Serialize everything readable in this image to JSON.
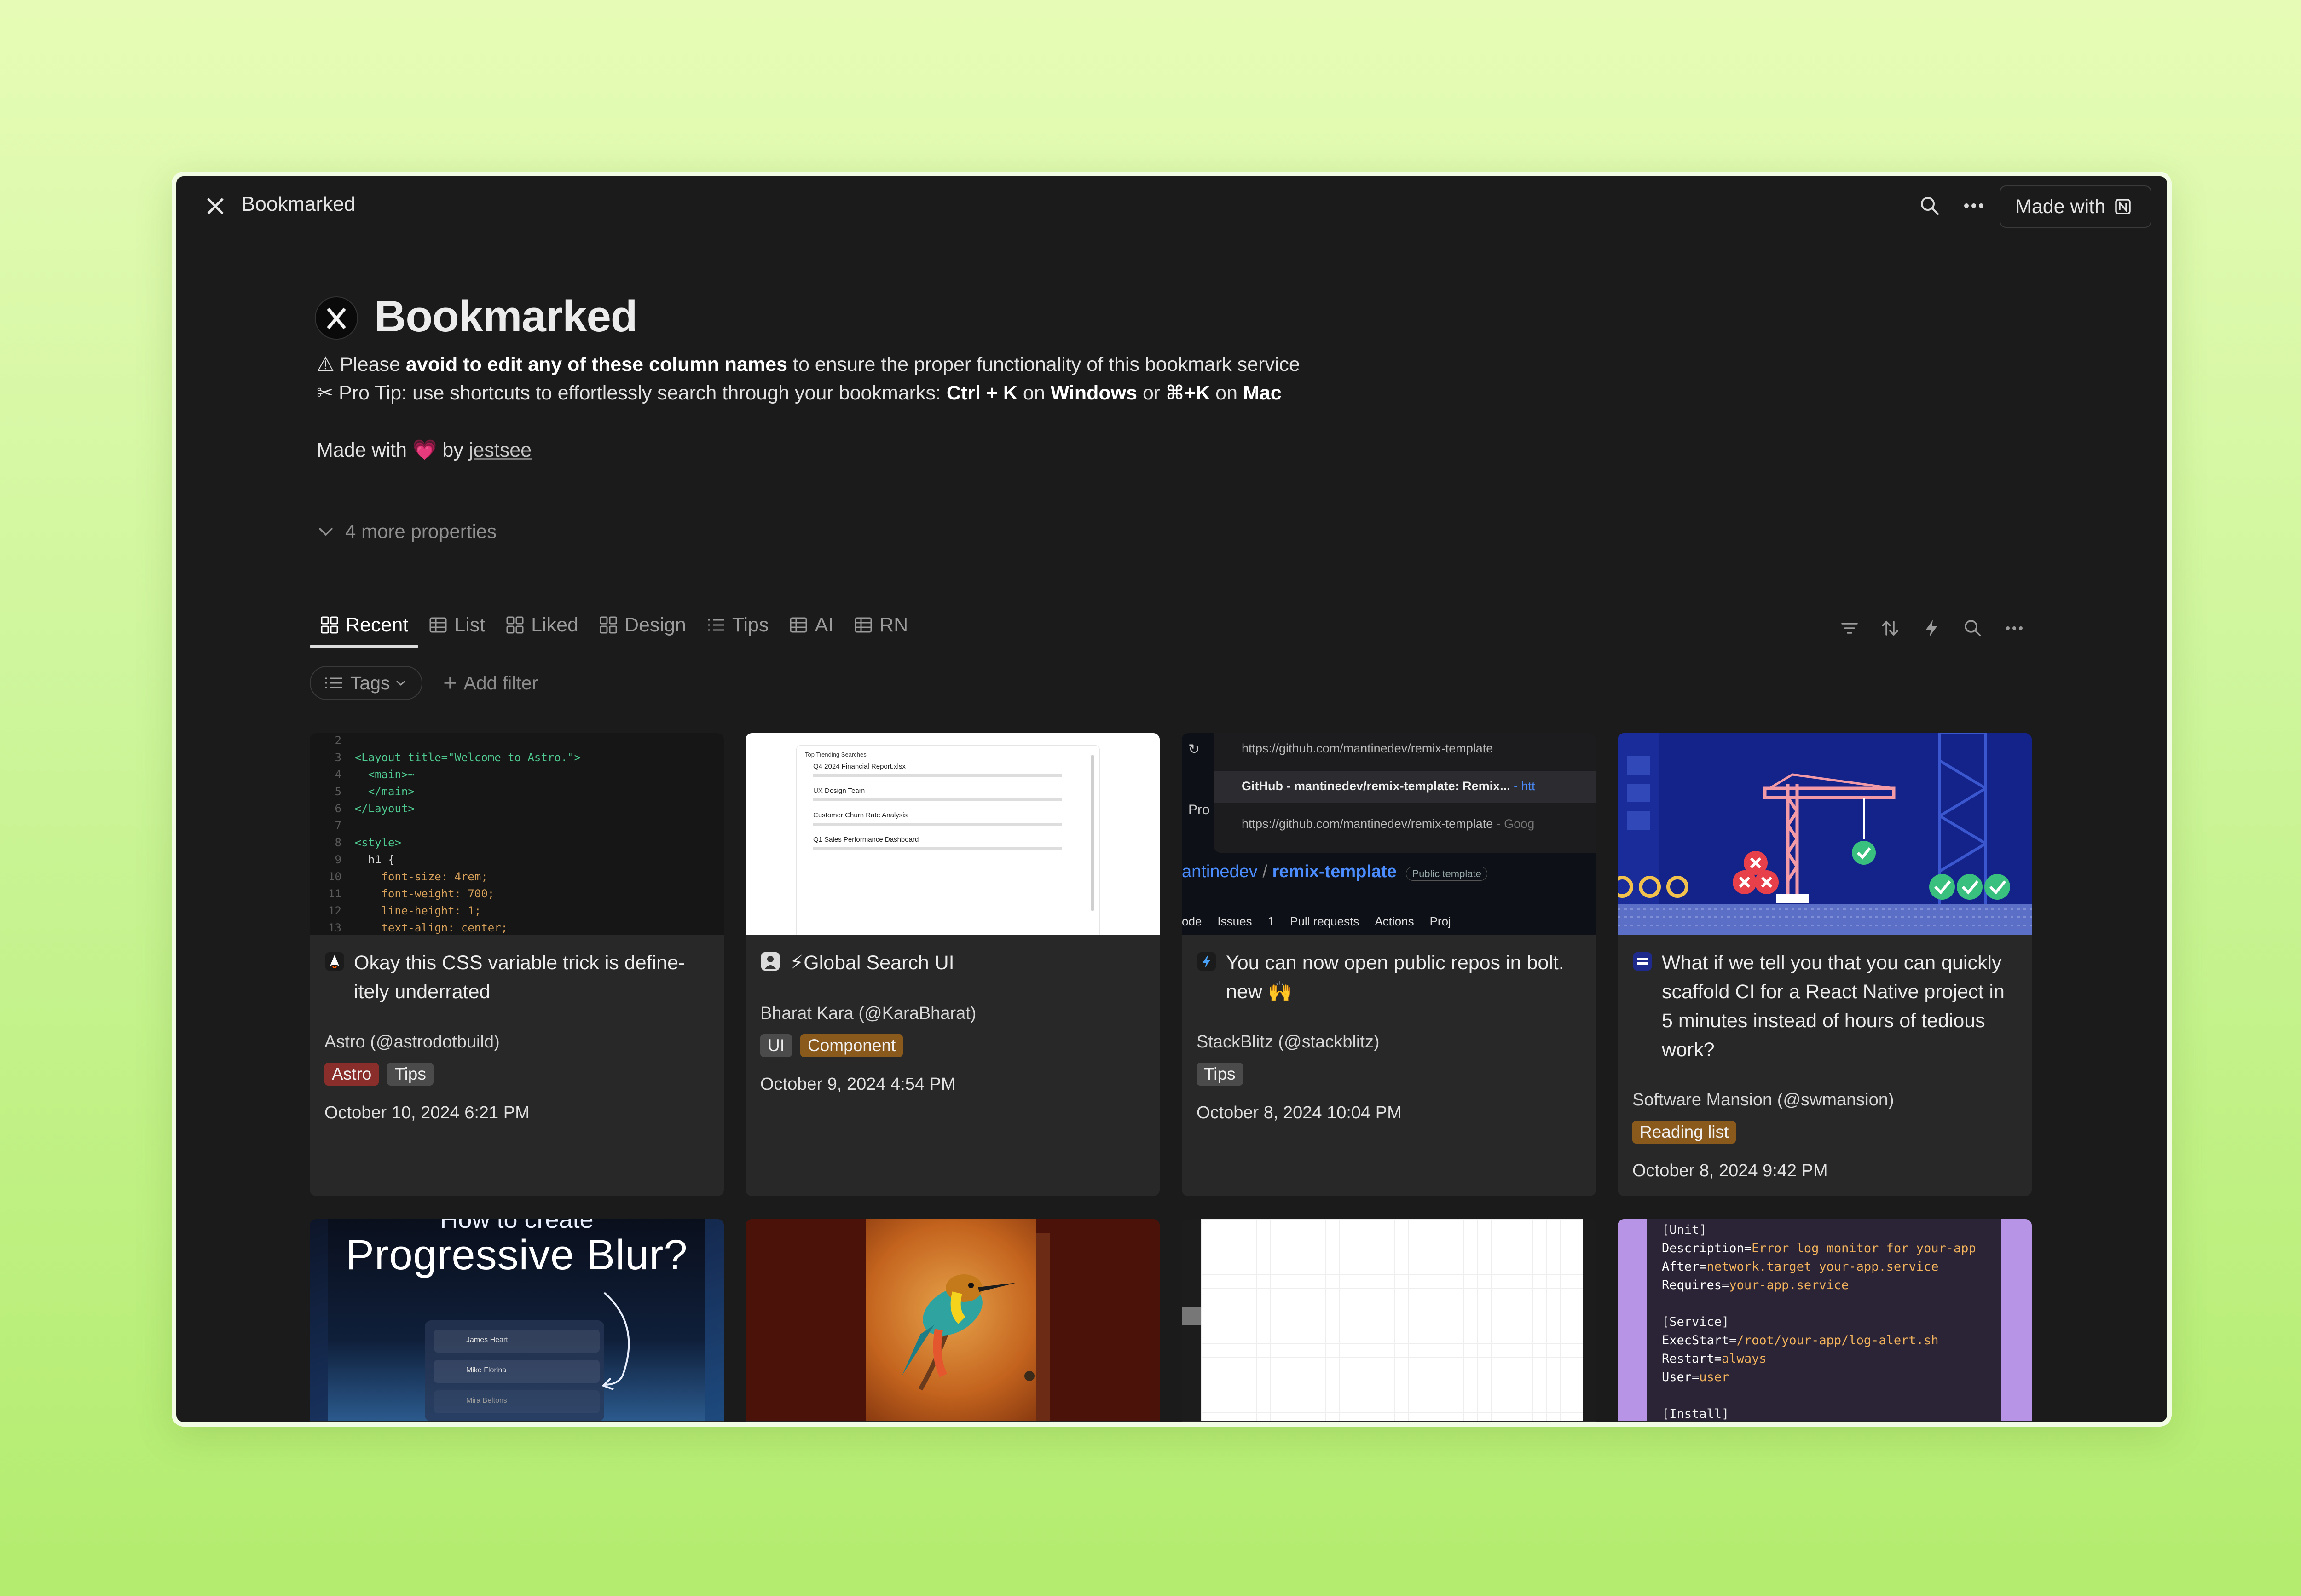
{
  "window": {
    "title": "Bookmarked",
    "made_with_label": "Made with"
  },
  "page": {
    "title": "Bookmarked",
    "line1": {
      "prefix": "⚠ Please ",
      "bold": "avoid to edit any of these column names",
      "suffix": " to ensure the proper functionality of this bookmark service"
    },
    "line2": {
      "prefix": "✂ Pro Tip: use shortcuts to effortlessly search through your bookmarks: ",
      "k1": "Ctrl + K",
      "on1": " on ",
      "os1": "Windows",
      "or": " or ",
      "k2": "⌘+K",
      "on2": " on ",
      "os2": "Mac"
    },
    "madewith": {
      "prefix": "Made with ",
      "heart": "💗",
      "by": " by ",
      "author": "jestsee"
    },
    "more_properties": "4 more properties"
  },
  "tabs": [
    {
      "label": "Recent",
      "icon": "gallery-icon",
      "active": true
    },
    {
      "label": "List",
      "icon": "table-icon"
    },
    {
      "label": "Liked",
      "icon": "gallery-icon"
    },
    {
      "label": "Design",
      "icon": "gallery-icon"
    },
    {
      "label": "Tips",
      "icon": "list-icon"
    },
    {
      "label": "AI",
      "icon": "table-icon"
    },
    {
      "label": "RN",
      "icon": "table-icon"
    }
  ],
  "filters": {
    "tags_label": "Tags",
    "add_filter_label": "Add filter"
  },
  "cards": [
    {
      "title": "Okay this CSS variable trick is define-itely underrated",
      "author": "Astro (@astrodotbuild)",
      "tags": [
        {
          "label": "Astro",
          "color": "#8a2e2b"
        },
        {
          "label": "Tips",
          "color": "#4b4b4b"
        }
      ],
      "date": "October 10, 2024 6:21 PM"
    },
    {
      "title": "⚡Global Search UI",
      "author": "Bharat Kara (@KaraBharat)",
      "tags": [
        {
          "label": "UI",
          "color": "#4b4b4b"
        },
        {
          "label": "Component",
          "color": "#8a5a1c"
        }
      ],
      "date": "October 9, 2024 4:54 PM"
    },
    {
      "title": "You can now open public repos in bolt. new 🙌",
      "author": "StackBlitz (@stackblitz)",
      "tags": [
        {
          "label": "Tips",
          "color": "#4b4b4b"
        }
      ],
      "date": "October 8, 2024 10:04 PM"
    },
    {
      "title": "What if we tell you that you can quickly scaffold CI for a React Native project in 5 minutes instead of hours of tedious work?",
      "author": "Software Mansion (@swmansion)",
      "tags": [
        {
          "label": "Reading list",
          "color": "#8a5a1c"
        }
      ],
      "date": "October 8, 2024 9:42 PM"
    }
  ],
  "thumbs": {
    "astro_code": [
      {
        "n": "2",
        "t": ""
      },
      {
        "n": "3",
        "t": "<Layout title=\"Welcome to Astro.\">"
      },
      {
        "n": "4",
        "t": "  <main>⋯"
      },
      {
        "n": "5",
        "t": "  </main>"
      },
      {
        "n": "6",
        "t": "</Layout>"
      },
      {
        "n": "7",
        "t": ""
      },
      {
        "n": "8",
        "t": "<style>"
      },
      {
        "n": "9",
        "t": "  h1 {"
      },
      {
        "n": "10",
        "t": "    font-size: 4rem;"
      },
      {
        "n": "11",
        "t": "    font-weight: 700;"
      },
      {
        "n": "12",
        "t": "    line-height: 1;"
      },
      {
        "n": "13",
        "t": "    text-align: center;"
      }
    ],
    "search_ui": {
      "heading": "Top Trending Searches",
      "items": [
        "Q4 2024 Financial Report.xlsx",
        "UX Design Team",
        "Customer Churn Rate Analysis",
        "Q1 Sales Performance Dashboard"
      ]
    },
    "github": {
      "row1": "https://github.com/mantinedev/remix-template",
      "row2": "GitHub - mantinedev/remix-template: Remix...",
      "row2_tail": " - htt",
      "row3": "https://github.com/mantinedev/remix-template",
      "row3_tail": " - Goog",
      "pro": "Pro",
      "repo_owner": "antinedev",
      "repo_name": "remix-template",
      "badge": "Public template",
      "nav": [
        "ode",
        "Issues",
        "1",
        "Pull requests",
        "Actions",
        "Proj"
      ]
    },
    "progressive": {
      "top": "How to create",
      "title": "Progressive Blur?",
      "names": [
        "James Heart",
        "Mike Florina",
        "Mira Beltons"
      ]
    },
    "systemd": [
      "[Unit]",
      "Description=Error log monitor for your-app",
      "After=network.target your-app.service",
      "Requires=your-app.service",
      "",
      "[Service]",
      "ExecStart=/root/your-app/log-alert.sh",
      "Restart=always",
      "User=user",
      "",
      "[Install]"
    ]
  },
  "colors": {
    "background": "#1b1b1b",
    "card": "#282828",
    "accent_red": "#8a2e2b",
    "accent_brown": "#8a5a1c"
  }
}
